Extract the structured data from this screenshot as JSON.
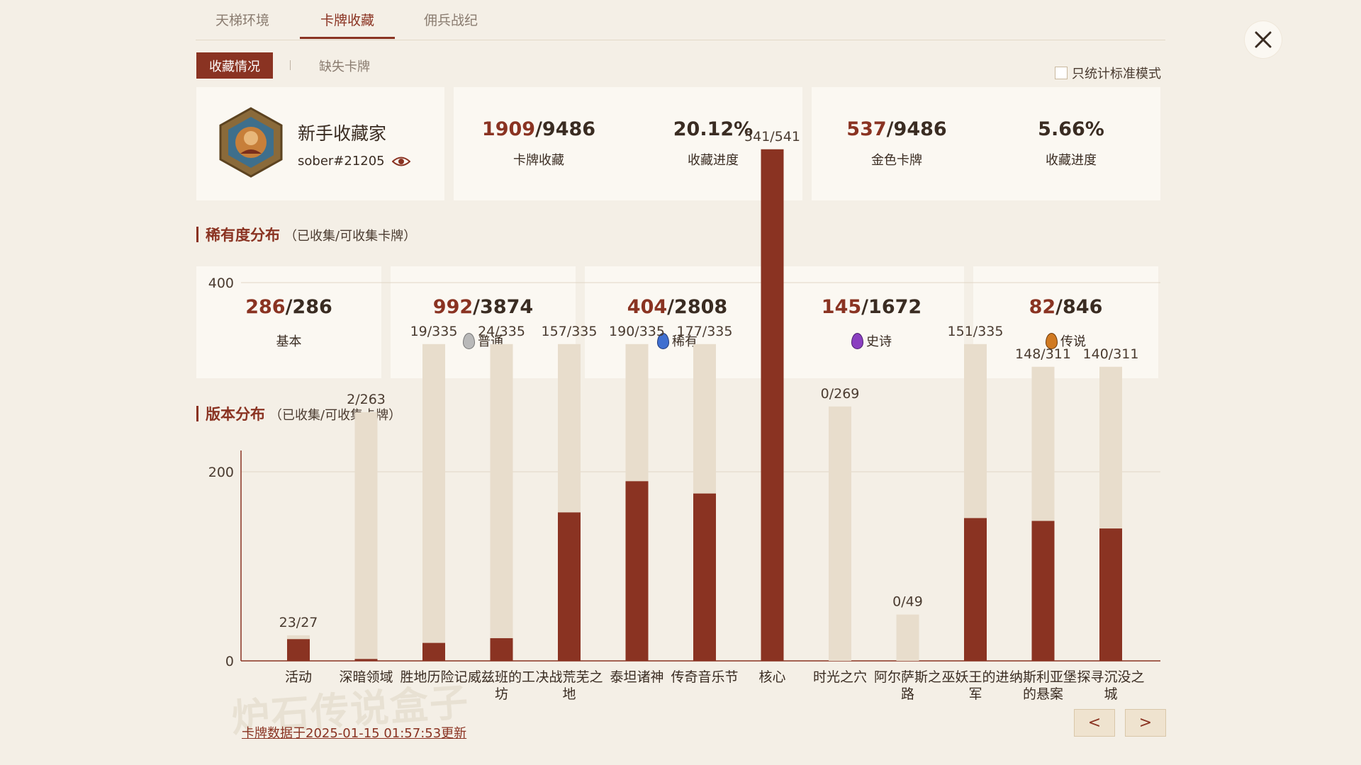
{
  "tabs": [
    {
      "label": "天梯环境",
      "active": false
    },
    {
      "label": "卡牌收藏",
      "active": true
    },
    {
      "label": "佣兵战纪",
      "active": false
    }
  ],
  "subtabs": {
    "primary": "收藏情况",
    "secondary": "缺失卡牌"
  },
  "standard_only_label": "只统计标准模式",
  "profile": {
    "title": "新手收藏家",
    "battletag": "sober#21205"
  },
  "stats": {
    "collection": {
      "owned": "1909",
      "total": "/9486",
      "label": "卡牌收藏"
    },
    "collection_progress": {
      "value": "20.12%",
      "label": "收藏进度"
    },
    "golden": {
      "owned": "537",
      "total": "/9486",
      "label": "金色卡牌"
    },
    "golden_progress": {
      "value": "5.66%",
      "label": "收藏进度"
    }
  },
  "rarity_section": {
    "title": "稀有度分布",
    "subtitle": "（已收集/可收集卡牌）"
  },
  "rarity": [
    {
      "owned": "286",
      "total": "/286",
      "label": "基本",
      "gem_color": ""
    },
    {
      "owned": "992",
      "total": "/3874",
      "label": "普通",
      "gem_color": "#b9b9b9"
    },
    {
      "owned": "404",
      "total": "/2808",
      "label": "稀有",
      "gem_color": "#3f6fd0"
    },
    {
      "owned": "145",
      "total": "/1672",
      "label": "史诗",
      "gem_color": "#8a3fc0"
    },
    {
      "owned": "82",
      "total": "/846",
      "label": "传说",
      "gem_color": "#d07a22"
    }
  ],
  "version_section": {
    "title": "版本分布",
    "subtitle": "（已收集/可收集卡牌）"
  },
  "chart_data": {
    "type": "bar",
    "categories": [
      "活动",
      "深暗领域",
      "胜地历险记",
      "威兹班的工坊",
      "决战荒芜之地",
      "泰坦诸神",
      "传奇音乐节",
      "核心",
      "时光之穴",
      "阿尔萨斯之路",
      "巫妖王的进军",
      "纳斯利亚堡的悬案",
      "探寻沉没之城"
    ],
    "series": [
      {
        "name": "",
        "values": [
          23,
          2,
          19,
          24,
          157,
          190,
          177,
          541,
          0,
          0,
          151,
          148,
          140
        ]
      },
      {
        "name": "",
        "values": [
          27,
          263,
          335,
          335,
          335,
          335,
          335,
          541,
          269,
          49,
          335,
          311,
          311
        ]
      }
    ],
    "data_labels": [
      "23/27",
      "2/263",
      "19/335",
      "24/335",
      "157/335",
      "190/335",
      "177/335",
      "541/541",
      "0/269",
      "0/49",
      "151/335",
      "148/311",
      "140/311"
    ],
    "yticks": [
      0,
      200,
      400
    ],
    "ylim": [
      0,
      450
    ],
    "grid": true,
    "colors": {
      "owned": "#8a3322",
      "total": "#e8ddcc"
    }
  },
  "footer": {
    "update_text": "卡牌数据于2025-01-15 01:57:53更新",
    "prev_label": "<",
    "next_label": ">",
    "watermark": "炉石传说盒子"
  }
}
